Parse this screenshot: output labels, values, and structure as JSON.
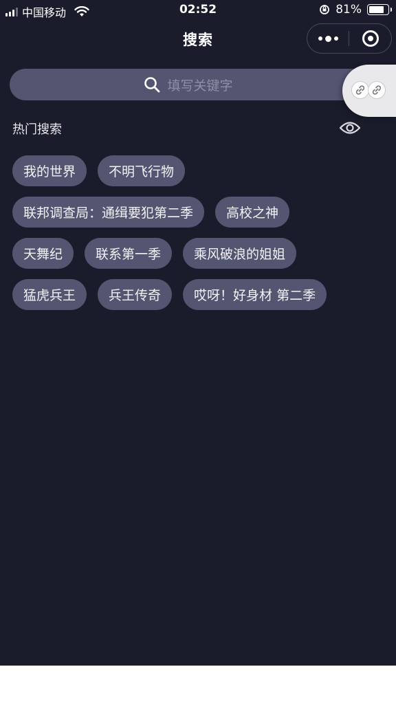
{
  "status_bar": {
    "carrier": "中国移动",
    "time": "02:52",
    "battery_percent": "81%",
    "battery_level": 0.81
  },
  "nav": {
    "title": "搜索",
    "more_icon": "more-dots-icon",
    "close_icon": "target-close-icon"
  },
  "search": {
    "placeholder": "填写关键字",
    "icon": "search-icon"
  },
  "floating": {
    "icon": "link-icon"
  },
  "hot": {
    "title": "热门搜索",
    "toggle_icon": "eye-icon",
    "rows": [
      [
        "我的世界",
        "不明飞行物"
      ],
      [
        "联邦调查局：通缉要犯第二季",
        "高校之神"
      ],
      [
        "天舞纪",
        "联系第一季",
        "乘风破浪的姐姐"
      ],
      [
        "猛虎兵王",
        "兵王传奇",
        "哎呀！好身材 第二季"
      ]
    ]
  },
  "colors": {
    "background": "#1b1c2b",
    "chip": "#545671",
    "placeholder": "#8e90a6"
  }
}
